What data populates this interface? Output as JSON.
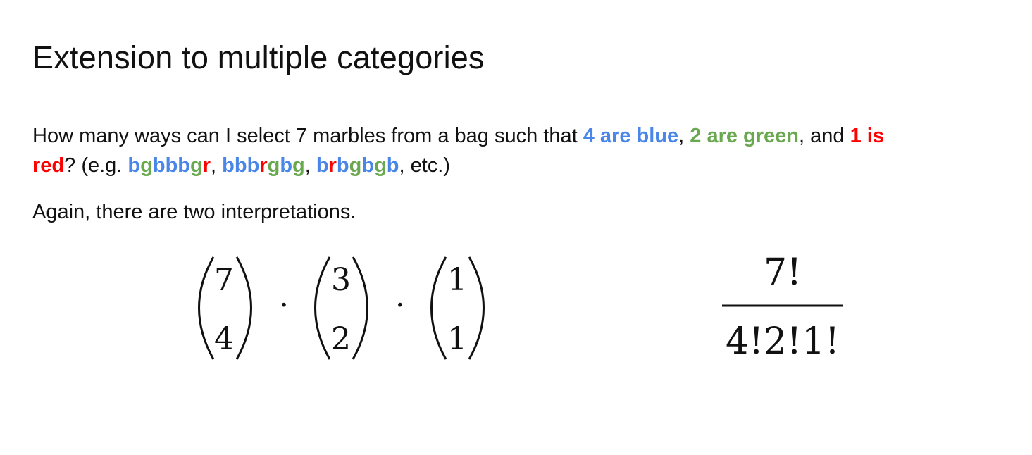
{
  "title": "Extension to multiple categories",
  "question": {
    "prefix": "How many ways can I select 7 marbles from a bag such that ",
    "blue_phrase": "4 are blue",
    "sep1": ", ",
    "green_phrase": "2 are green",
    "sep2": ", and ",
    "red_phrase_line1": "1 is",
    "red_phrase_line2": "red",
    "mid": "? (e.g. ",
    "examples": [
      [
        [
          "b",
          "blue"
        ],
        [
          "g",
          "green"
        ],
        [
          "b",
          "blue"
        ],
        [
          "b",
          "blue"
        ],
        [
          "b",
          "blue"
        ],
        [
          "g",
          "green"
        ],
        [
          "r",
          "red"
        ]
      ],
      [
        [
          "b",
          "blue"
        ],
        [
          "b",
          "blue"
        ],
        [
          "b",
          "blue"
        ],
        [
          "r",
          "red"
        ],
        [
          "g",
          "green"
        ],
        [
          "b",
          "blue"
        ],
        [
          "g",
          "green"
        ]
      ],
      [
        [
          "b",
          "blue"
        ],
        [
          "r",
          "red"
        ],
        [
          "b",
          "blue"
        ],
        [
          "g",
          "green"
        ],
        [
          "b",
          "blue"
        ],
        [
          "g",
          "green"
        ],
        [
          "b",
          "blue"
        ]
      ]
    ],
    "example_sep": ", ",
    "suffix": ", etc.)"
  },
  "interpretations_text": "Again, there are two interpretations.",
  "formula_left": {
    "binomials": [
      {
        "top": "7",
        "bottom": "4"
      },
      {
        "top": "3",
        "bottom": "2"
      },
      {
        "top": "1",
        "bottom": "1"
      }
    ],
    "operator": "·"
  },
  "formula_right": {
    "numerator": "7!",
    "denominator": "4!2!1!"
  },
  "colors": {
    "blue": "#4a86e8",
    "green": "#6aa84f",
    "red": "#ff0000",
    "text": "#111111"
  }
}
